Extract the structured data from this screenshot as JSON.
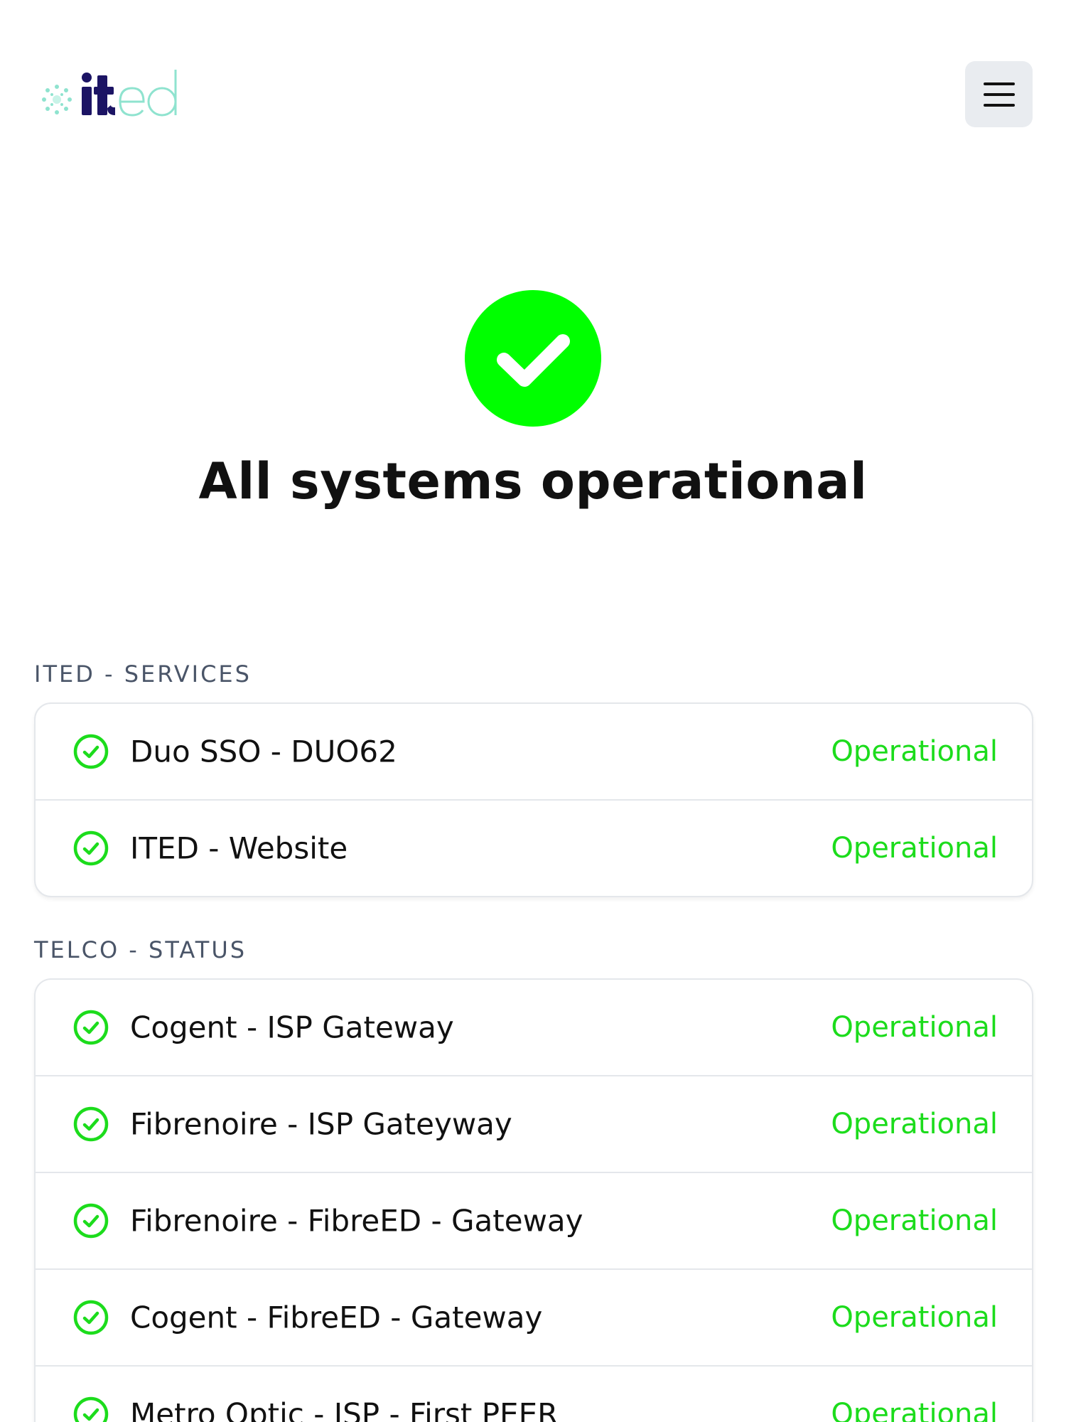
{
  "brand": {
    "logo_text_dark": "it",
    "logo_text_light": "ed",
    "primary_color": "#1c1464",
    "accent_color": "#8fe3cf"
  },
  "header": {
    "menu_icon": "hamburger-icon"
  },
  "hero": {
    "status_icon": "check-circle-icon",
    "status_color": "#00ff00",
    "title": "All systems operational"
  },
  "colors": {
    "operational": "#1cdc1c"
  },
  "groups": [
    {
      "label": "ITED - SERVICES",
      "services": [
        {
          "name": "Duo SSO - DUO62",
          "status": "Operational"
        },
        {
          "name": "ITED - Website",
          "status": "Operational"
        }
      ]
    },
    {
      "label": "TELCO - STATUS",
      "services": [
        {
          "name": "Cogent - ISP Gateway",
          "status": "Operational"
        },
        {
          "name": "Fibrenoire - ISP Gateyway",
          "status": "Operational"
        },
        {
          "name": "Fibrenoire - FibreED - Gateway",
          "status": "Operational"
        },
        {
          "name": "Cogent - FibreED - Gateway",
          "status": "Operational"
        },
        {
          "name": "Metro Optic - ISP - First PEER",
          "status": "Operational"
        }
      ]
    }
  ]
}
